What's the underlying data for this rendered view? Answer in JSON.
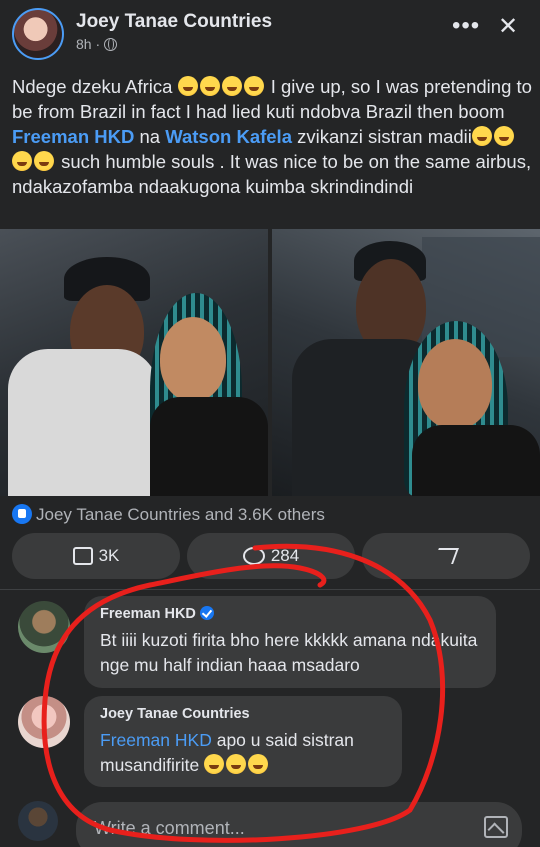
{
  "post": {
    "author": "Joey Tanae Countries",
    "time": "8h ·",
    "text_part1": "Ndege dzeku Africa ",
    "text_part2": " I give up, so I was pretending to be from Brazil in fact I had lied kuti ndobva Brazil then boom ",
    "mention1": "Freeman HKD",
    "text_part3": " na ",
    "mention2": "Watson Kafela",
    "text_part4": " zvikanzi sistran madii",
    "text_part5": " such humble souls . It was nice to be on the same airbus, ndakazofamba ndaakugona kuimba skrindindindi"
  },
  "reactions": {
    "summary": "Joey Tanae Countries and 3.6K others"
  },
  "actions": {
    "like_count": "3K",
    "comment_count": "284"
  },
  "comments": [
    {
      "author": "Freeman HKD",
      "text": "Bt iiii kuzoti firita bho here kkkkk  amana ndakuita nge mu half indian haaa msadaro"
    },
    {
      "author": "Joey Tanae Countries",
      "mention": "Freeman HKD",
      "text": " apo u said sistran musandifirite "
    }
  ],
  "composer": {
    "placeholder": "Write a comment..."
  },
  "colors": {
    "background": "#242526",
    "mention": "#4b9cf5",
    "annotation": "#e8201c"
  }
}
